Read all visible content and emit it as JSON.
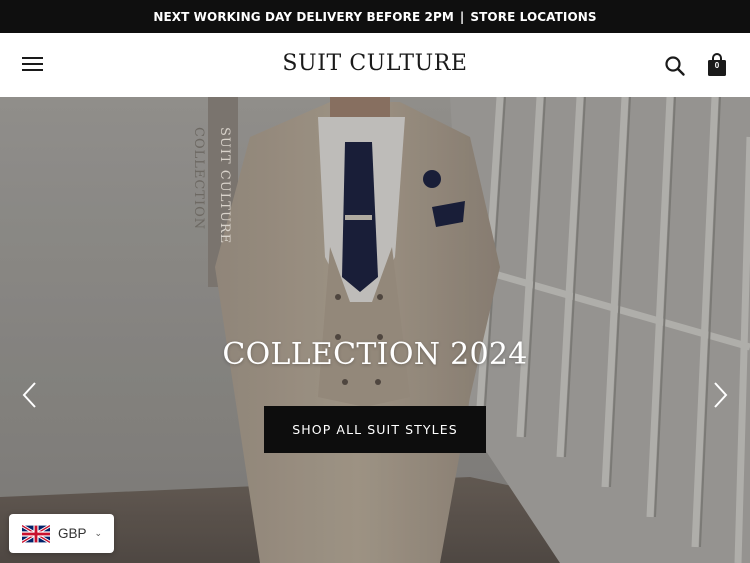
{
  "announcement": {
    "delivery_text": "NEXT WORKING DAY DELIVERY BEFORE 2PM",
    "separator": "|",
    "store_text": "STORE LOCATIONS"
  },
  "header": {
    "logo": "SUIT CULTURE",
    "cart_count": "0",
    "menu_icon": "hamburger-icon",
    "search_icon": "search-icon",
    "cart_icon": "shopping-bag-icon"
  },
  "hero": {
    "title": "COLLECTION 2024",
    "cta_label": "SHOP ALL SUIT STYLES",
    "banner_text_1": "SUIT CULTURE",
    "banner_text_2": "COLLECTION",
    "prev_icon": "chevron-left-icon",
    "next_icon": "chevron-right-icon"
  },
  "currency": {
    "code": "GBP",
    "caret": "⌄",
    "flag_icon": "uk-flag-icon"
  }
}
